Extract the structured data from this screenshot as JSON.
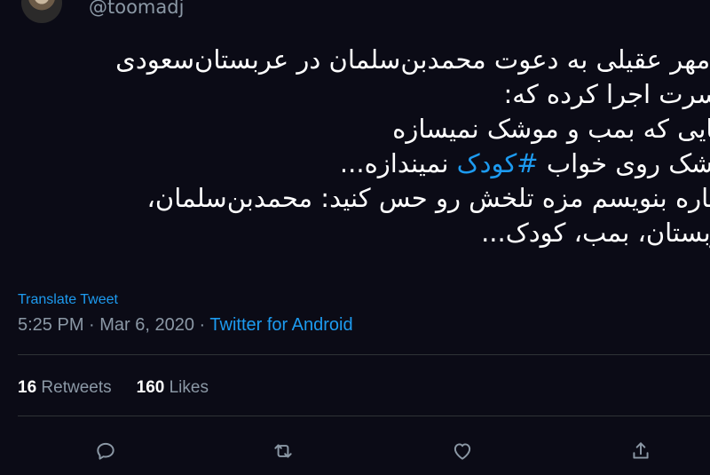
{
  "author": {
    "handle": "@toomadj"
  },
  "tweet": {
    "lines": [
      "دادمهر عقیلی به دعوت محمدبن‌سلمان در عربستان‌سعودی",
      "کنسرت اجرا کرده که:",
      "دنیایی که بمب و موشک نمیسازه",
      "موشک روی خواب",
      "#کودک",
      "نمیندازه...",
      "دوباره بنویسم مزه تلخش رو حس کنید: محمدبن‌سلمان،",
      "عربستان، بمب، کودک..."
    ]
  },
  "translate_label": "Translate Tweet",
  "meta": {
    "time": "5:25 PM",
    "separator": " · ",
    "date": "Mar 6, 2020",
    "source": "Twitter for Android"
  },
  "stats": {
    "retweets_count": "16",
    "retweets_label": "Retweets",
    "likes_count": "160",
    "likes_label": "Likes"
  },
  "actions": {
    "icons": [
      "reply-icon",
      "retweet-icon",
      "like-icon",
      "share-icon"
    ]
  },
  "colors": {
    "background": "#0b0b16",
    "accent": "#1d9bf0",
    "secondary_text": "#8b98a5",
    "divider": "#2f3336"
  }
}
